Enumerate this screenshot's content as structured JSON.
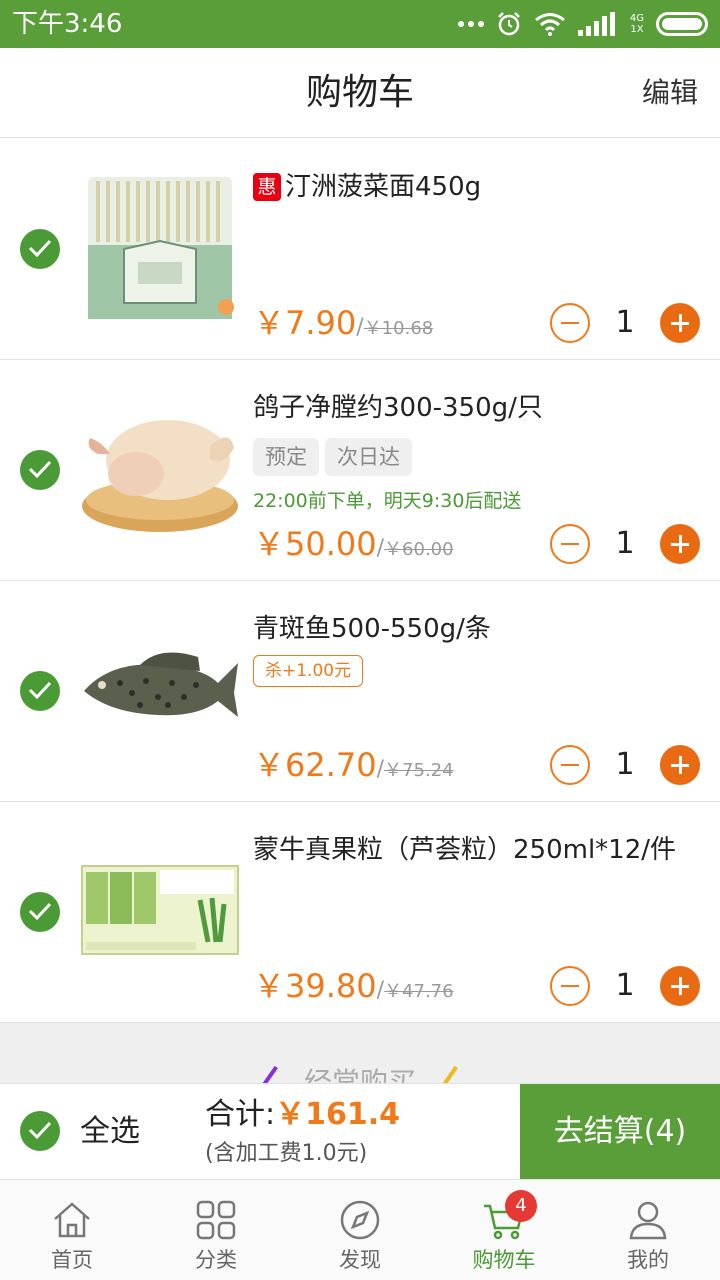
{
  "status_bar": {
    "time": "下午3:46",
    "network_top": "4G",
    "network_bottom": "1X"
  },
  "header": {
    "title": "购物车",
    "edit_label": "编辑"
  },
  "items": [
    {
      "name": "汀洲菠菜面450g",
      "badge": "惠",
      "price": "￥7.90",
      "old_price": "￥10.68",
      "qty": "1",
      "checked": true,
      "image_icon": "spinach-noodle-pack-icon"
    },
    {
      "name": "鸽子净膛约300-350g/只",
      "tags": [
        "预定",
        "次日达"
      ],
      "delivery_note": "22:00前下单，明天9:30后配送",
      "price": "￥50.00",
      "old_price": "￥60.00",
      "qty": "1",
      "checked": true,
      "image_icon": "pigeon-icon"
    },
    {
      "name": "青斑鱼500-550g/条",
      "promo": "杀+1.00元",
      "price": "￥62.70",
      "old_price": "￥75.24",
      "qty": "1",
      "checked": true,
      "image_icon": "grouper-fish-icon"
    },
    {
      "name": "蒙牛真果粒（芦荟粒）250ml*12/件",
      "price": "￥39.80",
      "old_price": "￥47.76",
      "qty": "1",
      "checked": true,
      "image_icon": "yogurt-box-icon"
    }
  ],
  "frequently_bought": {
    "title": "经常购买"
  },
  "checkout": {
    "select_all_label": "全选",
    "total_label": "合计:",
    "total_value": "￥161.4",
    "fee_note": "(含加工费1.0元)",
    "button_label": "去结算(4)"
  },
  "tabs": [
    {
      "label": "首页",
      "icon": "home-icon"
    },
    {
      "label": "分类",
      "icon": "grid-icon"
    },
    {
      "label": "发现",
      "icon": "compass-icon"
    },
    {
      "label": "购物车",
      "icon": "cart-icon",
      "active": true,
      "badge": "4"
    },
    {
      "label": "我的",
      "icon": "user-icon"
    }
  ],
  "colors": {
    "primary_green": "#5a9e3a",
    "accent_orange": "#f07a1a",
    "badge_red": "#e53935"
  }
}
